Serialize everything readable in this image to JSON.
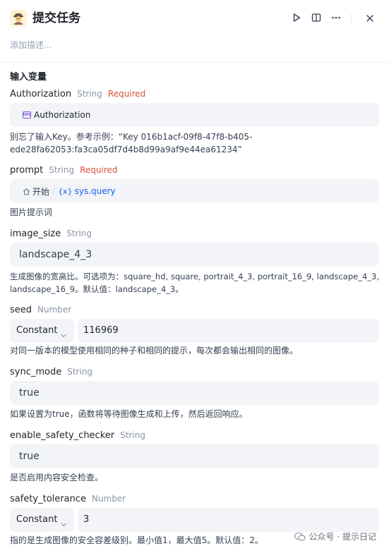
{
  "header": {
    "title": "提交任务",
    "app_icon": "detective-emoji-icon",
    "actions": [
      "play-icon",
      "split-view-icon",
      "more-icon",
      "close-icon"
    ]
  },
  "description_placeholder": "添加描述...",
  "section_title": "输入变量",
  "fields": {
    "authorization": {
      "name": "Authorization",
      "type": "String",
      "required": "Required",
      "chip_badge": "ENV",
      "value": "Authorization",
      "hint_line1": "别忘了输入Key。参考示例：“Key 016b1acf-09f8-47f8-b405-",
      "hint_line2": "ede28fa62053:fa3ca05df7d4b8d99a9af9e44ea61234”"
    },
    "prompt": {
      "name": "prompt",
      "type": "String",
      "required": "Required",
      "node": "开始",
      "separator": "/",
      "var_badge": "{x}",
      "variable": "sys.query",
      "hint": "图片提示词"
    },
    "image_size": {
      "name": "image_size",
      "type": "String",
      "value": "landscape_4_3",
      "hint_line1": "生成图像的宽高比。可选项为：square_hd, square, portrait_4_3, portrait_16_9, landscape_4_3,",
      "hint_line2": "landscape_16_9。默认值：landscape_4_3。"
    },
    "seed": {
      "name": "seed",
      "type": "Number",
      "mode": "Constant",
      "value": "116969",
      "hint": "对同一版本的模型使用相同的种子和相同的提示，每次都会输出相同的图像。"
    },
    "sync_mode": {
      "name": "sync_mode",
      "type": "String",
      "value": "true",
      "hint": "如果设置为true，函数将等待图像生成和上传，然后返回响应。"
    },
    "enable_safety_checker": {
      "name": "enable_safety_checker",
      "type": "String",
      "value": "true",
      "hint": "是否启用内容安全检查。"
    },
    "safety_tolerance": {
      "name": "safety_tolerance",
      "type": "Number",
      "mode": "Constant",
      "value": "3",
      "hint": "指的是生成图像的安全容差级别。最小值1，最大值5。默认值：2。"
    }
  },
  "watermark": "公众号 · 提示日记",
  "colors": {
    "required": "#d9513c",
    "variable": "#155eef",
    "env": "#7f56d9",
    "field_bg": "#f2f4f7"
  }
}
